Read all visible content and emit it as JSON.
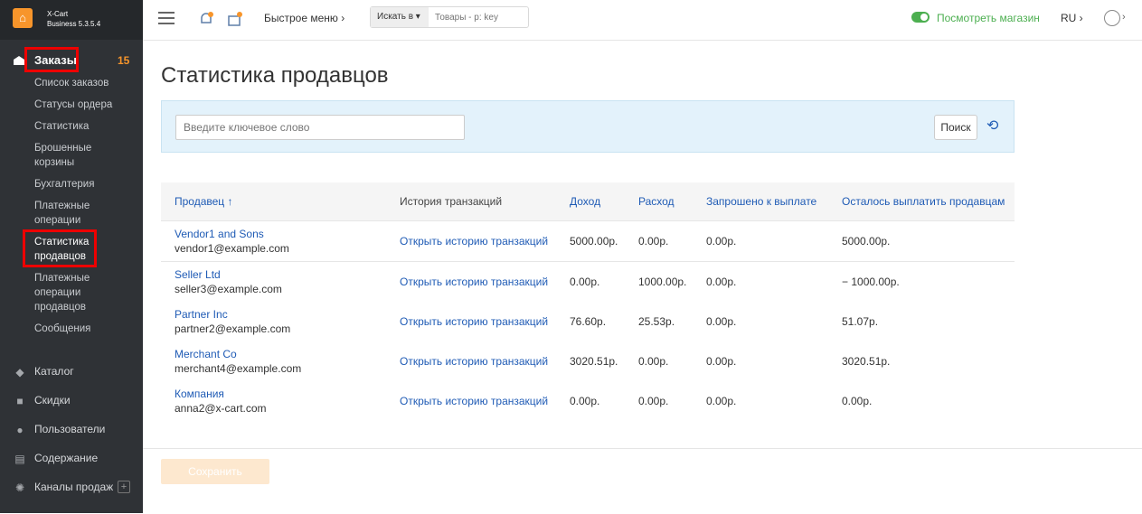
{
  "app": {
    "name_line1": "X-Cart",
    "name_line2": "Business 5.3.5.4"
  },
  "sidebar": {
    "orders_label": "Заказы",
    "orders_badge": "15",
    "sub_items": [
      "Список заказов",
      "Статусы ордера",
      "Статистика",
      "Брошенные корзины",
      "Бухгалтерия",
      "Платежные операции",
      "Статистика продавцов",
      "Платежные операции продавцов",
      "Сообщения"
    ],
    "main_items": [
      {
        "label": "Каталог",
        "icon": "tag-icon"
      },
      {
        "label": "Скидки",
        "icon": "gift-icon"
      },
      {
        "label": "Пользователи",
        "icon": "users-icon"
      },
      {
        "label": "Содержание",
        "icon": "content-icon"
      },
      {
        "label": "Каналы продаж",
        "icon": "sales-channels-icon"
      }
    ]
  },
  "topbar": {
    "quick_menu": "Быстрое меню",
    "search_scope": "Искать в",
    "search_placeholder": "Товары - p: key",
    "view_store": "Посмотреть магазин",
    "lang": "RU"
  },
  "page": {
    "title": "Статистика продавцов",
    "keyword_placeholder": "Введите ключевое слово",
    "search_button": "Поиск",
    "save_button": "Сохранить"
  },
  "table": {
    "headers": [
      "Продавец ↑",
      "История транзакций",
      "Доход",
      "Расход",
      "Запрошено к выплате",
      "Осталось выплатить продавцам"
    ],
    "history_link": "Открыть историю транзакций",
    "rows": [
      {
        "vendor": "Vendor1 and Sons",
        "email": "vendor1@example.com",
        "income": "5000.00р.",
        "expense": "0.00р.",
        "requested": "0.00р.",
        "remaining": "5000.00р."
      },
      {
        "vendor": "Seller Ltd",
        "email": "seller3@example.com",
        "income": "0.00р.",
        "expense": "1000.00р.",
        "requested": "0.00р.",
        "remaining": "− 1000.00р."
      },
      {
        "vendor": "Partner Inc",
        "email": "partner2@example.com",
        "income": "76.60р.",
        "expense": "25.53р.",
        "requested": "0.00р.",
        "remaining": "51.07р."
      },
      {
        "vendor": "Merchant Co",
        "email": "merchant4@example.com",
        "income": "3020.51р.",
        "expense": "0.00р.",
        "requested": "0.00р.",
        "remaining": "3020.51р."
      },
      {
        "vendor": "Компания",
        "email": "anna2@x-cart.com",
        "income": "0.00р.",
        "expense": "0.00р.",
        "requested": "0.00р.",
        "remaining": "0.00р."
      }
    ]
  }
}
